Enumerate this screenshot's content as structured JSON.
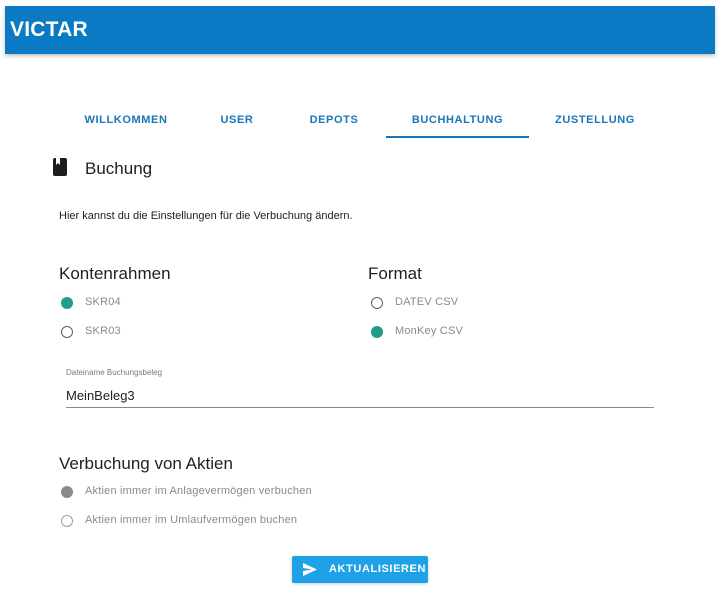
{
  "app": {
    "title": "VICTAR"
  },
  "tabs": [
    {
      "label": "WILLKOMMEN"
    },
    {
      "label": "USER"
    },
    {
      "label": "DEPOTS"
    },
    {
      "label": "BUCHHALTUNG",
      "active": true
    },
    {
      "label": "ZUSTELLUNG"
    }
  ],
  "section": {
    "icon": "book-icon",
    "title": "Buchung"
  },
  "description": "Hier kannst du die Einstellungen für die Verbuchung ändern.",
  "kontenrahmen": {
    "title": "Kontenrahmen",
    "options": [
      {
        "label": "SKR04",
        "checked": true
      },
      {
        "label": "SKR03",
        "checked": false
      }
    ]
  },
  "format": {
    "title": "Format",
    "options": [
      {
        "label": "DATEV CSV",
        "checked": false
      },
      {
        "label": "MonKey CSV",
        "checked": true
      }
    ]
  },
  "dateiname": {
    "label": "Dateiname Buchungsbeleg",
    "value": "MeinBeleg3"
  },
  "aktien": {
    "title": "Verbuchung von Aktien",
    "options": [
      {
        "label": "Aktien immer im Anlagevermögen verbuchen",
        "checked": true
      },
      {
        "label": "Aktien immer im Umlaufvermögen buchen",
        "checked": false
      }
    ]
  },
  "button": {
    "label": "AKTUALISIEREN",
    "icon": "send-icon"
  },
  "colors": {
    "appbar": "#0a7ac4",
    "accent": "#1a76b8",
    "radio_checked": "#1f9c8a",
    "button": "#1fa1e8"
  }
}
